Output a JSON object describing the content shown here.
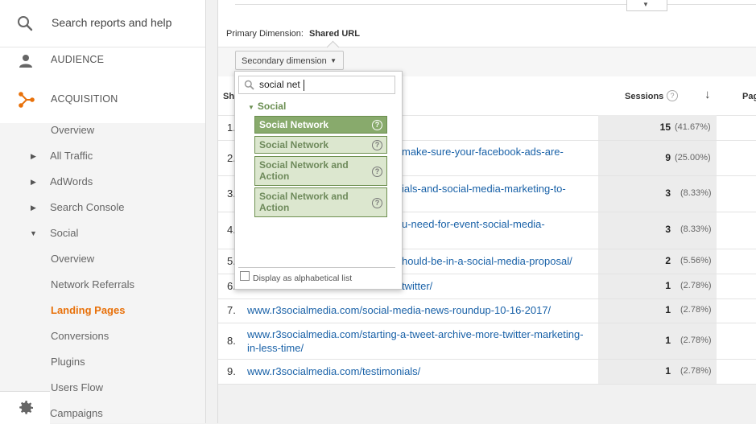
{
  "sidebar": {
    "search_placeholder": "Search reports and help",
    "audience": "AUDIENCE",
    "acquisition": "ACQUISITION",
    "items": {
      "overview": "Overview",
      "all_traffic": "All Traffic",
      "adwords": "AdWords",
      "search_console": "Search Console",
      "social": "Social",
      "social_overview": "Overview",
      "network_referrals": "Network Referrals",
      "landing_pages": "Landing Pages",
      "conversions": "Conversions",
      "plugins": "Plugins",
      "users_flow": "Users Flow",
      "campaigns": "Campaigns"
    },
    "active_color": "#e8710a"
  },
  "report": {
    "primary_dimension_label": "Primary Dimension:",
    "primary_dimension_value": "Shared URL",
    "secondary_dimension_button": "Secondary dimension",
    "columns": {
      "shared_url": "Sha",
      "sessions": "Sessions",
      "pages": "Pag"
    },
    "rows": [
      {
        "num": "1.",
        "url": "",
        "sessions": "15",
        "pct": "(41.67%)"
      },
      {
        "num": "2.",
        "url": "make-sure-your-facebook-ads-are-",
        "sessions": "9",
        "pct": "(25.00%)"
      },
      {
        "num": "3.",
        "url": "ials-and-social-media-marketing-to-",
        "sessions": "3",
        "pct": "(8.33%)"
      },
      {
        "num": "4.",
        "url": "u-need-for-event-social-media-",
        "sessions": "3",
        "pct": "(8.33%)"
      },
      {
        "num": "5.",
        "url": "hould-be-in-a-social-media-proposal/",
        "sessions": "2",
        "pct": "(5.56%)"
      },
      {
        "num": "6.",
        "url": "twitter/",
        "sessions": "1",
        "pct": "(2.78%)"
      },
      {
        "num": "7.",
        "url": "www.r3socialmedia.com/social-media-news-roundup-10-16-2017/",
        "sessions": "1",
        "pct": "(2.78%)"
      },
      {
        "num": "8.",
        "url": "www.r3socialmedia.com/starting-a-tweet-archive-more-twitter-marketing-in-less-time/",
        "sessions": "1",
        "pct": "(2.78%)"
      },
      {
        "num": "9.",
        "url": "www.r3socialmedia.com/testimonials/",
        "sessions": "1",
        "pct": "(2.78%)"
      }
    ]
  },
  "dropdown": {
    "search_value": "social net",
    "group": "Social",
    "options": [
      {
        "label": "Social Network",
        "selected": true
      },
      {
        "label": "Social Network",
        "selected": false
      },
      {
        "label": "Social Network and Action",
        "selected": false
      },
      {
        "label": "Social Network and Action",
        "selected": false
      }
    ],
    "help_glyph": "?",
    "alphabetical_label": "Display as alphabetical list"
  },
  "icons": {
    "search": "search-icon",
    "person": "person-icon",
    "acquisition": "acquisition-icon",
    "gear": "gear-icon",
    "sort_desc": "arrow-down-icon",
    "help": "help-icon"
  }
}
